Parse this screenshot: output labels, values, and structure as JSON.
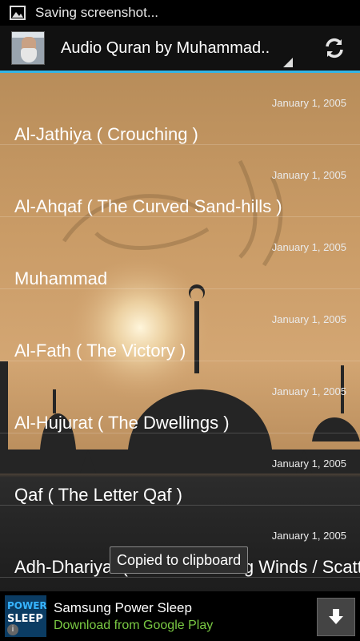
{
  "status_bar": {
    "notification_icon": "image-icon",
    "text": "Saving screenshot..."
  },
  "action_bar": {
    "title": "Audio Quran by Muhammad..",
    "app_icon": "app-icon-portrait",
    "refresh_icon": "refresh-icon",
    "accent_color": "#33b5e5"
  },
  "list": {
    "items": [
      {
        "date": "January 1, 2005",
        "title": "Al-Jathiya ( Crouching )"
      },
      {
        "date": "January 1, 2005",
        "title": "Al-Ahqaf ( The Curved Sand-hills )"
      },
      {
        "date": "January 1, 2005",
        "title": "Muhammad"
      },
      {
        "date": "January 1, 2005",
        "title": "Al-Fath ( The Victory )"
      },
      {
        "date": "January 1, 2005",
        "title": "Al-Hujurat ( The Dwellings )"
      },
      {
        "date": "January 1, 2005",
        "title": "Qaf ( The Letter Qaf )"
      },
      {
        "date": "January 1, 2005",
        "title": "Adh-Dhariyat ( The Winnowing Winds / Scatter )"
      }
    ]
  },
  "toast": {
    "text": "Copied to clipboard"
  },
  "ad": {
    "logo_line1": "POWER",
    "logo_line2": "SLEEP",
    "title": "Samsung Power Sleep",
    "subtitle": "Download from Google Play",
    "info_icon": "info-icon",
    "download_icon": "download-icon",
    "info_label": "i"
  }
}
